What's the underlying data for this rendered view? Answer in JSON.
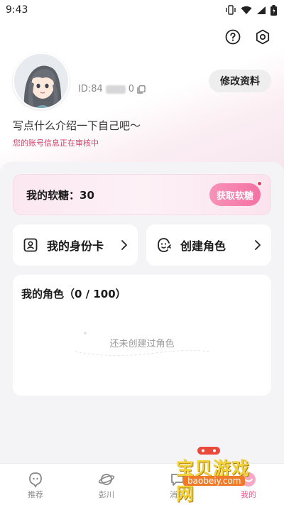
{
  "status_bar": {
    "time": "9:43"
  },
  "profile": {
    "id_label": "ID:84",
    "id_suffix": "0",
    "edit_button": "修改资料",
    "bio": "写点什么介绍一下自己吧～",
    "review_notice": "您的账号信息正在审核中"
  },
  "candy": {
    "label": "我的软糖：30",
    "button": "获取软糖"
  },
  "tiles": {
    "identity_card": "我的身份卡",
    "create_role": "创建角色"
  },
  "roles": {
    "title": "我的角色（0 / 100）",
    "empty_text": "还未创建过角色"
  },
  "tabbar": {
    "items": [
      {
        "label": "推荐",
        "icon": "recommend-icon"
      },
      {
        "label": "彭川",
        "icon": "planet-icon"
      },
      {
        "label": "消息",
        "icon": "message-icon"
      },
      {
        "label": "我的",
        "icon": "profile-icon"
      }
    ],
    "active": "我的"
  },
  "watermark": {
    "text": "宝贝游戏网",
    "url": "baobeiy.com"
  },
  "colors": {
    "accent": "#f0588f",
    "review": "#d0416c",
    "background": "#f4f4f6"
  }
}
